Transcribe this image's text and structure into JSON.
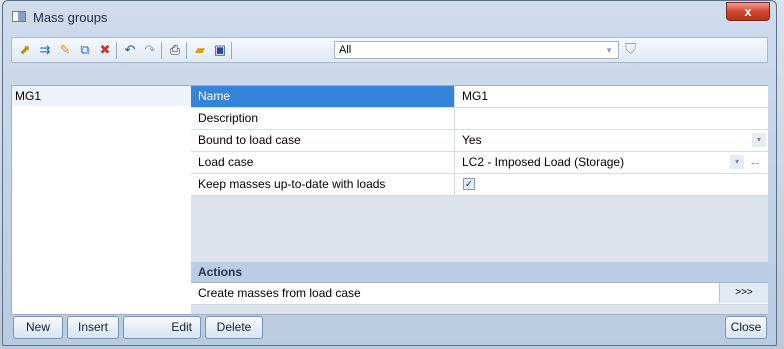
{
  "window": {
    "title": "Mass groups",
    "close_label": "x"
  },
  "toolbar": {
    "icons": [
      "new-icon",
      "insert-icon",
      "edit-icon",
      "copy-icon",
      "delete-icon",
      "undo-icon",
      "redo-icon",
      "print-icon",
      "open-icon",
      "save-icon"
    ],
    "filter_label": "All"
  },
  "list": {
    "items": [
      "MG1"
    ]
  },
  "properties": {
    "rows": [
      {
        "label": "Name",
        "value": "MG1"
      },
      {
        "label": "Description",
        "value": ""
      },
      {
        "label": "Bound to load case",
        "value": "Yes"
      },
      {
        "label": "Load case",
        "value": "LC2 - Imposed Load (Storage)"
      },
      {
        "label": "Keep masses up-to-date with loads",
        "value": "✓"
      }
    ]
  },
  "actions": {
    "header": "Actions",
    "items": [
      {
        "label": "Create masses from load case",
        "button": ">>>"
      }
    ]
  },
  "buttons": {
    "new": "New",
    "insert": "Insert",
    "edit": "Edit",
    "delete": "Delete",
    "close": "Close"
  }
}
